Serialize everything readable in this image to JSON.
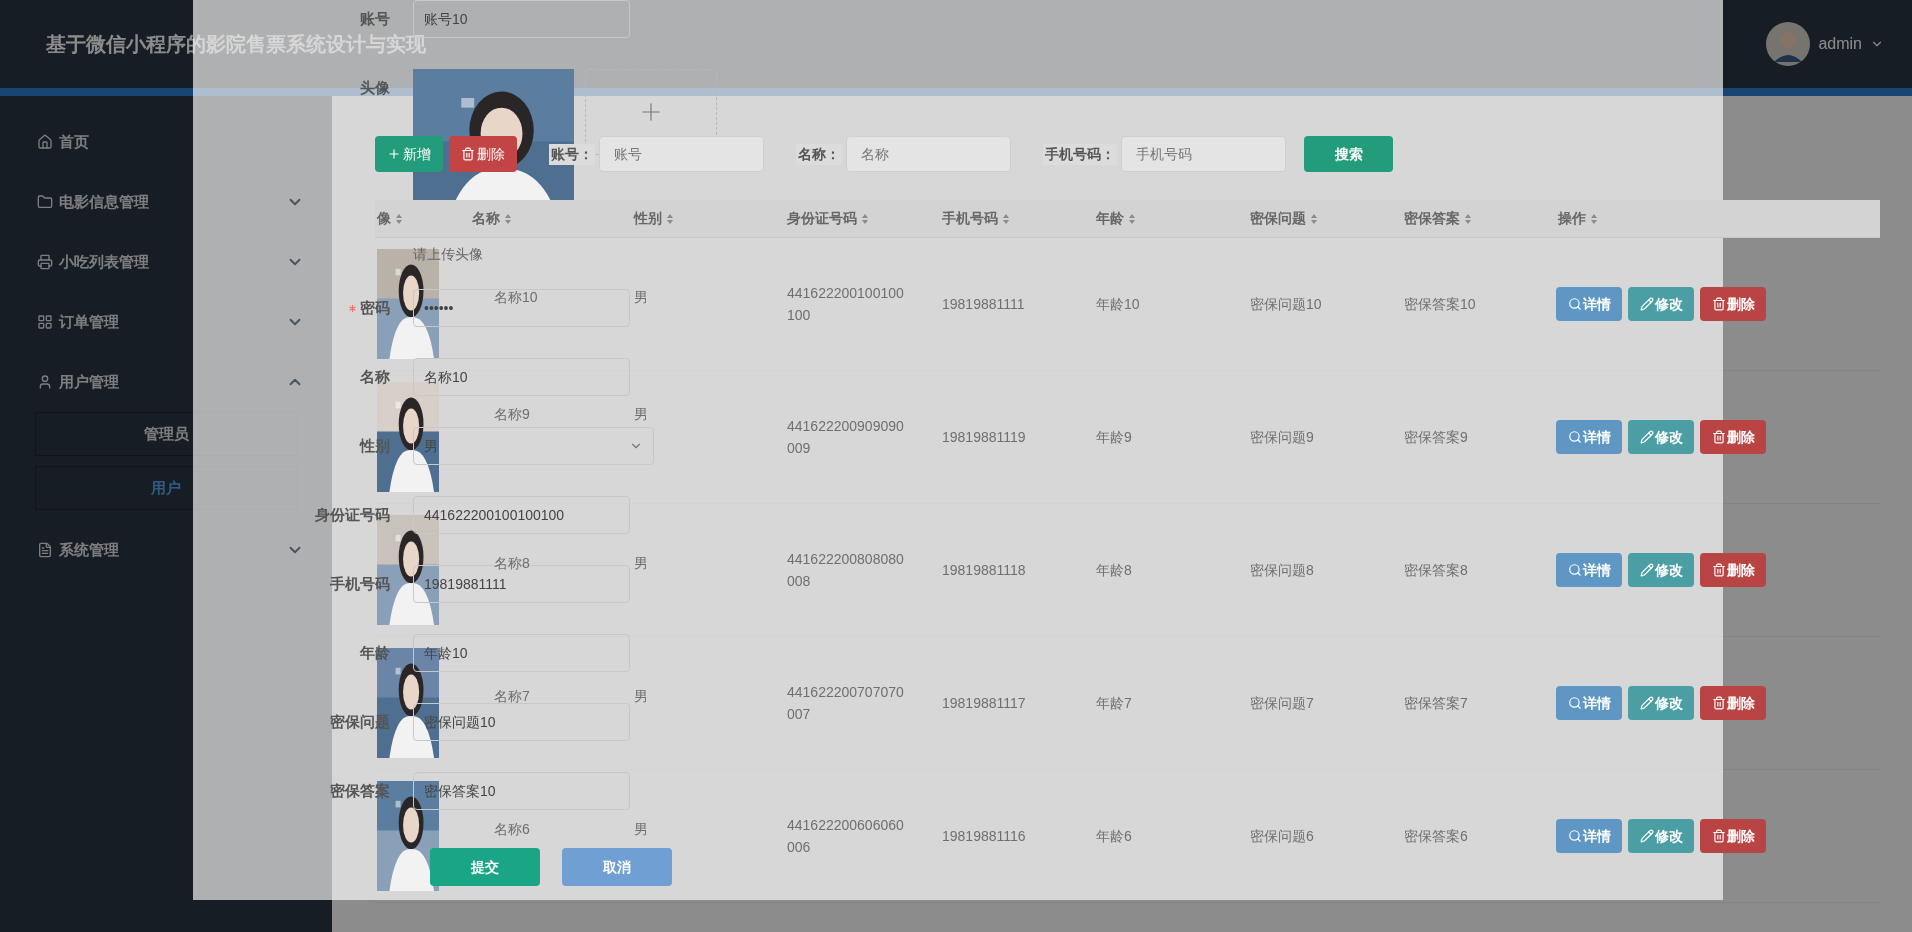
{
  "header": {
    "title": "基于微信小程序的影院售票系统设计与实现",
    "user": "admin"
  },
  "sidebar": {
    "items": [
      {
        "label": "首页"
      },
      {
        "label": "电影信息管理",
        "expanded": false
      },
      {
        "label": "小吃列表管理",
        "expanded": false
      },
      {
        "label": "订单管理",
        "expanded": false
      },
      {
        "label": "用户管理",
        "expanded": true,
        "children": [
          {
            "label": "管理员",
            "selected": false
          },
          {
            "label": "用户",
            "selected": true
          }
        ]
      },
      {
        "label": "系统管理",
        "expanded": false
      }
    ]
  },
  "toolbar": {
    "add": "新增",
    "delete": "删除",
    "filters": [
      {
        "label": "账号：",
        "placeholder": "账号"
      },
      {
        "label": "名称：",
        "placeholder": "名称"
      },
      {
        "label": "手机号码：",
        "placeholder": "手机号码"
      }
    ],
    "search": "搜索"
  },
  "table": {
    "columns": [
      "像",
      "名称",
      "性别",
      "身份证号码",
      "手机号码",
      "年龄",
      "密保问题",
      "密保答案",
      "操作"
    ],
    "rows": [
      {
        "name": "名称10",
        "gender": "男",
        "id_number": "441622200100100100",
        "phone": "19819881111",
        "age": "年龄10",
        "question": "密保问题10",
        "answer": "密保答案10",
        "actions": [
          "详情",
          "修改",
          "删除"
        ]
      },
      {
        "name": "名称9",
        "gender": "男",
        "id_number": "441622200909090009",
        "phone": "19819881119",
        "age": "年龄9",
        "question": "密保问题9",
        "answer": "密保答案9",
        "actions": [
          "详情",
          "修改",
          "删除"
        ]
      },
      {
        "name": "名称8",
        "gender": "男",
        "id_number": "441622200808080008",
        "phone": "19819881118",
        "age": "年龄8",
        "question": "密保问题8",
        "answer": "密保答案8",
        "actions": [
          "详情",
          "修改",
          "删除"
        ]
      },
      {
        "name": "名称7",
        "gender": "男",
        "id_number": "441622200707070007",
        "phone": "19819881117",
        "age": "年龄7",
        "question": "密保问题7",
        "answer": "密保答案7",
        "actions": [
          "详情",
          "修改",
          "删除"
        ]
      },
      {
        "name": "名称6",
        "gender": "男",
        "id_number": "441622200606060006",
        "phone": "19819881116",
        "age": "年龄6",
        "question": "密保问题6",
        "answer": "密保答案6",
        "actions": [
          "详情",
          "修改",
          "删除"
        ]
      }
    ]
  },
  "form": {
    "fields": [
      {
        "label": "账号",
        "kind": "text",
        "value": "账号10",
        "required": false
      },
      {
        "label": "头像",
        "hint": "请上传头像",
        "required": false
      },
      {
        "label": "密码",
        "kind": "password",
        "value": "••••••",
        "required": true
      },
      {
        "label": "名称",
        "kind": "text",
        "value": "名称10",
        "required": false
      },
      {
        "label": "性别",
        "kind": "select",
        "value": "男",
        "required": false
      },
      {
        "label": "身份证号码",
        "kind": "text",
        "value": "441622200100100100",
        "required": false
      },
      {
        "label": "手机号码",
        "kind": "text",
        "value": "19819881111",
        "required": false
      },
      {
        "label": "年龄",
        "kind": "text",
        "value": "年龄10",
        "required": false
      },
      {
        "label": "密保问题",
        "kind": "text",
        "value": "密保问题10",
        "required": false
      },
      {
        "label": "密保答案",
        "kind": "text",
        "value": "密保答案10",
        "required": false
      }
    ],
    "buttons": [
      {
        "label": "提交",
        "kind": "primary"
      },
      {
        "label": "取消",
        "kind": "secondary"
      }
    ]
  }
}
